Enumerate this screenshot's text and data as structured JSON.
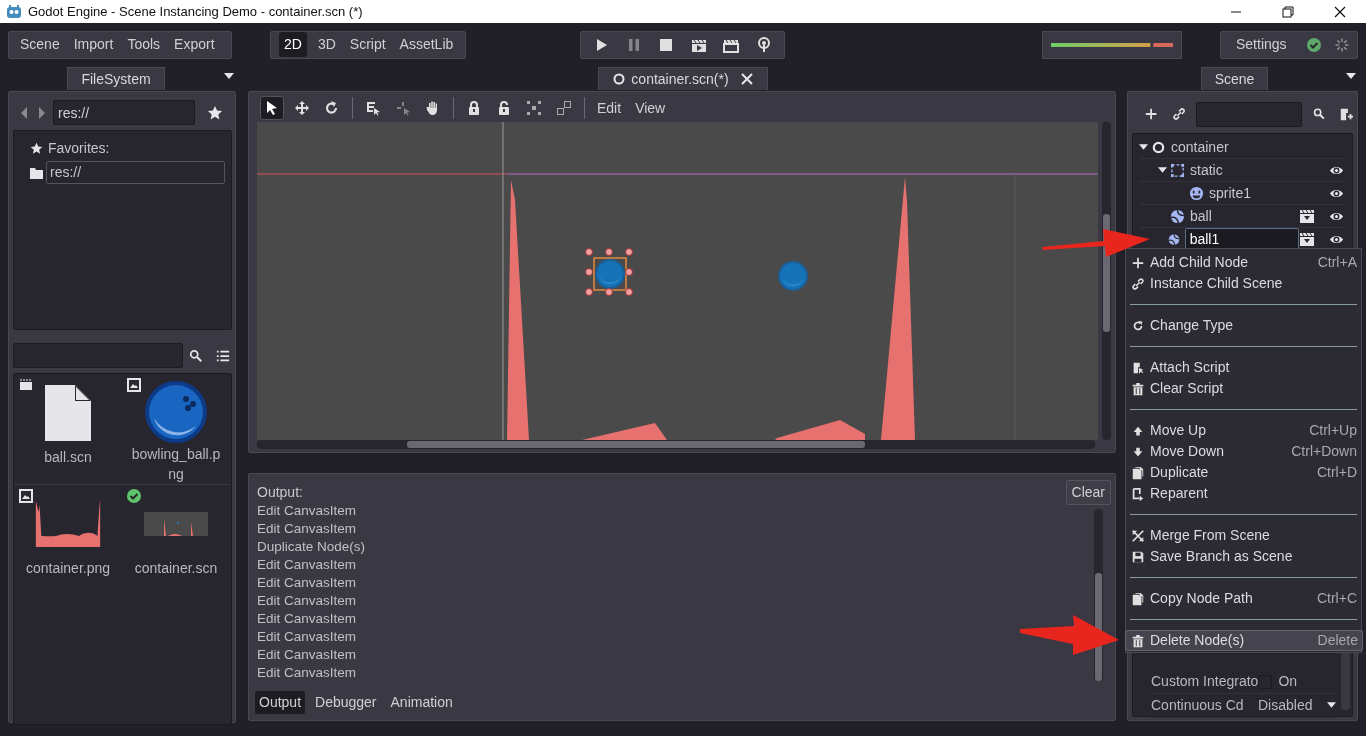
{
  "window": {
    "title": "Godot Engine - Scene Instancing Demo - container.scn (*)"
  },
  "main_menu": [
    "Scene",
    "Import",
    "Tools",
    "Export"
  ],
  "workspaces": [
    {
      "label": "2D",
      "selected": true
    },
    {
      "label": "3D",
      "selected": false
    },
    {
      "label": "Script",
      "selected": false
    },
    {
      "label": "AssetLib",
      "selected": false
    }
  ],
  "play_controls": [
    {
      "disabled": false
    },
    {
      "disabled": true
    },
    {
      "disabled": false
    },
    {
      "disabled": false
    },
    {
      "disabled": false
    },
    {
      "disabled": false
    }
  ],
  "settings": {
    "label": "Settings"
  },
  "filesystem": {
    "tab": "FileSystem",
    "path": "res://",
    "favorites_label": "Favorites:",
    "favorites": [
      {
        "label": "res://",
        "selected": true
      }
    ],
    "files": [
      {
        "name": "ball.scn"
      },
      {
        "name": "bowling_ball.png"
      },
      {
        "name": "container.png"
      },
      {
        "name": "container.scn"
      }
    ]
  },
  "scene_tab": {
    "label": "container.scn(*)"
  },
  "canvas_toolbar": [
    {
      "selected": true,
      "disabled": false
    },
    {
      "selected": false,
      "disabled": false
    },
    {
      "selected": false,
      "disabled": false
    },
    {
      "selected": false,
      "disabled": false
    },
    {
      "selected": false,
      "disabled": true
    },
    {
      "selected": false,
      "disabled": false
    },
    {
      "selected": false,
      "disabled": false
    },
    {
      "selected": false,
      "disabled": false
    },
    {
      "selected": false,
      "disabled": false
    },
    {
      "selected": false,
      "disabled": false
    }
  ],
  "canvas_menus": [
    "Edit",
    "View"
  ],
  "output": {
    "title": "Output:",
    "clear": "Clear",
    "lines": [
      "Edit CanvasItem",
      "Edit CanvasItem",
      "Duplicate Node(s)",
      "Edit CanvasItem",
      "Edit CanvasItem",
      "Edit CanvasItem",
      "Edit CanvasItem",
      "Edit CanvasItem",
      "Edit CanvasItem",
      "Edit CanvasItem"
    ]
  },
  "bottom_tabs": [
    {
      "label": "Output",
      "selected": true
    },
    {
      "label": "Debugger",
      "selected": false
    },
    {
      "label": "Animation",
      "selected": false
    }
  ],
  "scene_dock": {
    "tab": "Scene",
    "tree": [
      {
        "label": "container",
        "selected": false,
        "expanded": true,
        "children": [
          {
            "label": "static",
            "selected": false,
            "expanded": true,
            "visible": true,
            "children": [
              {
                "label": "sprite1",
                "selected": false,
                "visible": true
              }
            ]
          },
          {
            "label": "ball",
            "selected": false,
            "instanced": true,
            "visible": true
          },
          {
            "label": "ball1",
            "selected": true,
            "instanced": true,
            "visible": true
          }
        ]
      }
    ]
  },
  "inspector": [
    {
      "kind": "check",
      "label": "Custom Integrato",
      "value": "On",
      "checked": false
    },
    {
      "kind": "enum",
      "label": "Continuous Cd",
      "value": "Disabled"
    }
  ],
  "context_menu": [
    {
      "kind": "item",
      "label": "Add Child Node",
      "shortcut": "Ctrl+A",
      "selected": false
    },
    {
      "kind": "item",
      "label": "Instance Child Scene",
      "selected": false
    },
    {
      "kind": "separator"
    },
    {
      "kind": "item",
      "label": "Change Type",
      "selected": false
    },
    {
      "kind": "separator"
    },
    {
      "kind": "item",
      "label": "Attach Script",
      "selected": false
    },
    {
      "kind": "item",
      "label": "Clear Script",
      "selected": false
    },
    {
      "kind": "separator"
    },
    {
      "kind": "item",
      "label": "Move Up",
      "shortcut": "Ctrl+Up",
      "selected": false
    },
    {
      "kind": "item",
      "label": "Move Down",
      "shortcut": "Ctrl+Down",
      "selected": false
    },
    {
      "kind": "item",
      "label": "Duplicate",
      "shortcut": "Ctrl+D",
      "selected": false
    },
    {
      "kind": "item",
      "label": "Reparent",
      "selected": false
    },
    {
      "kind": "separator"
    },
    {
      "kind": "item",
      "label": "Merge From Scene",
      "selected": false
    },
    {
      "kind": "item",
      "label": "Save Branch as Scene",
      "selected": false
    },
    {
      "kind": "separator"
    },
    {
      "kind": "item",
      "label": "Copy Node Path",
      "shortcut": "Ctrl+C",
      "selected": false
    },
    {
      "kind": "separator"
    },
    {
      "kind": "item",
      "label": "Delete Node(s)",
      "shortcut": "Delete",
      "selected": true
    }
  ]
}
